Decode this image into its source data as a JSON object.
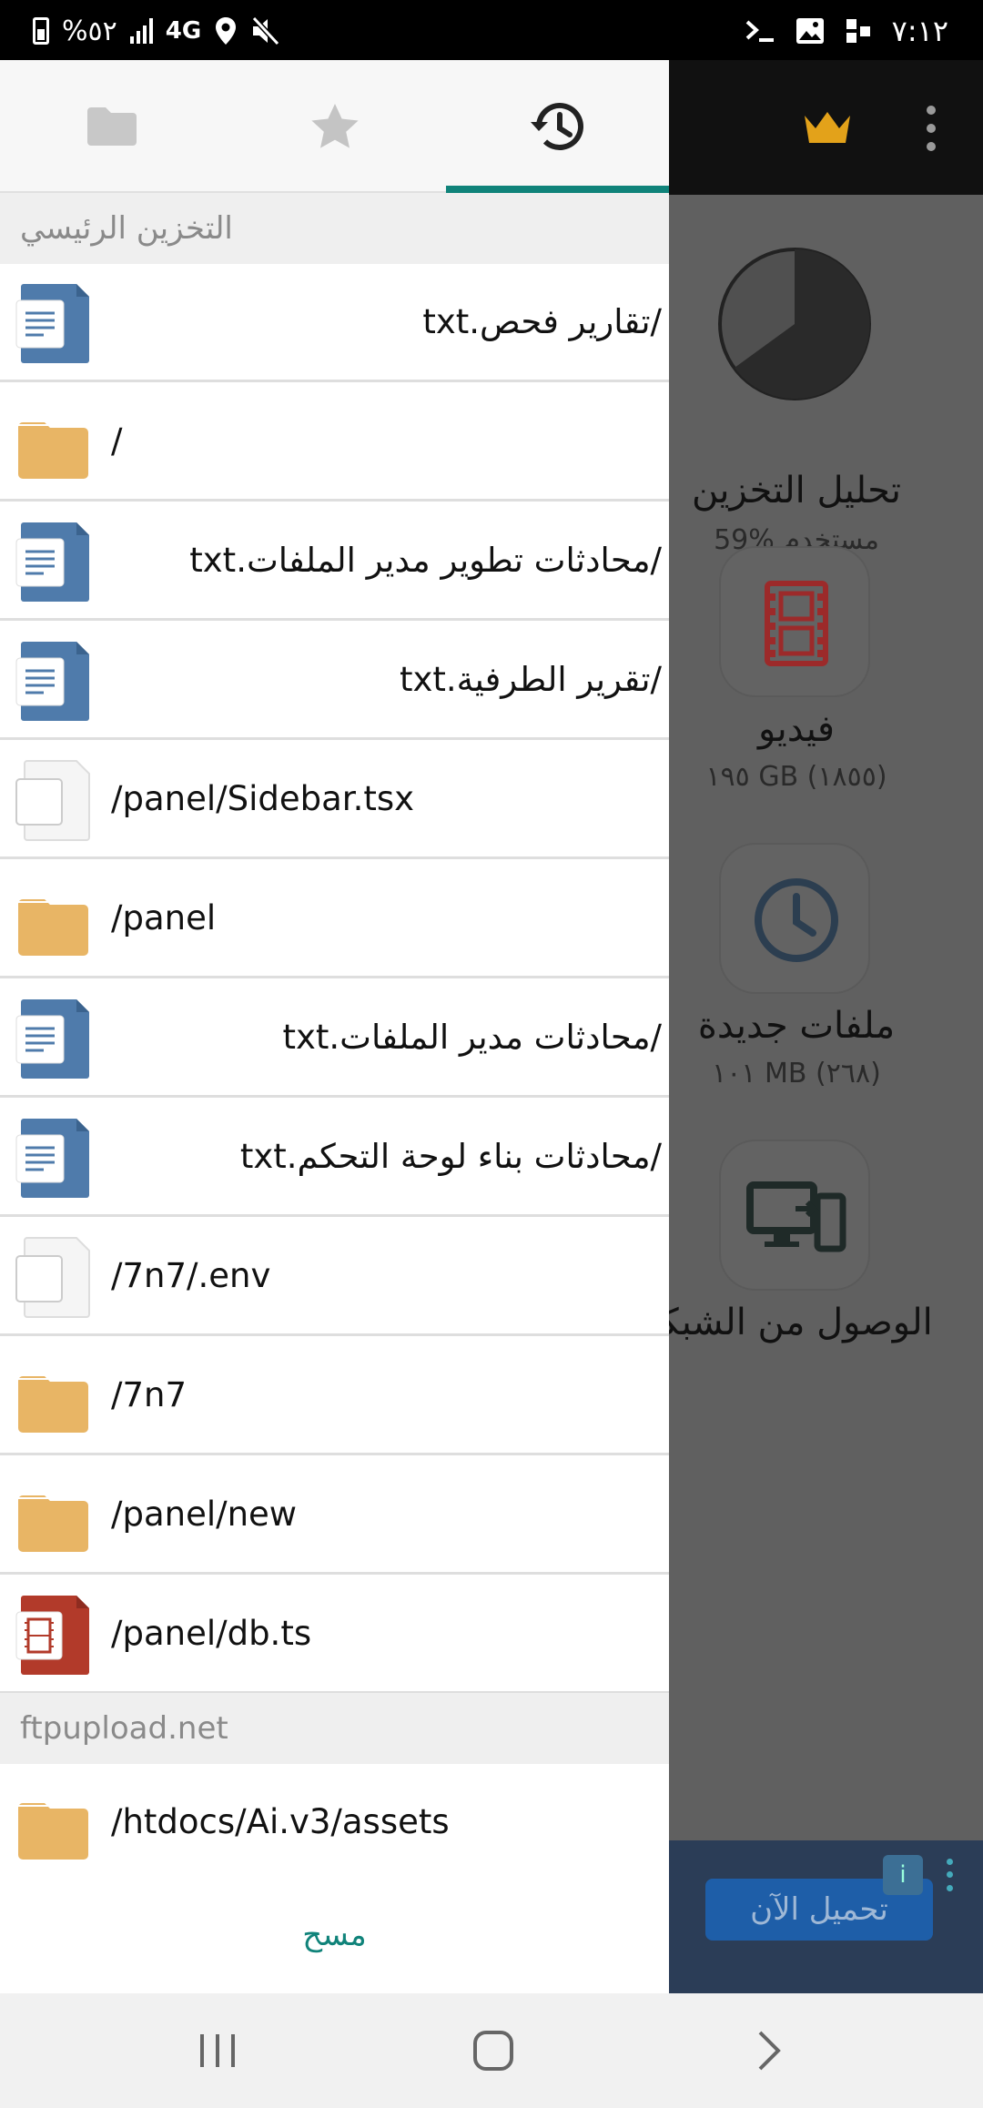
{
  "status_bar": {
    "battery_text": "%٥٢",
    "network": "4G",
    "time": "٧:١٢"
  },
  "drawer": {
    "tabs": [
      {
        "icon": "folder-icon",
        "active": false
      },
      {
        "icon": "star-icon",
        "active": false
      },
      {
        "icon": "history-icon",
        "active": true
      }
    ],
    "sections": [
      {
        "title": "التخزين الرئيسي",
        "items": [
          {
            "label": "/تقارير فحص.txt",
            "type": "text-file",
            "dir": "rtl"
          },
          {
            "label": "/",
            "type": "folder",
            "dir": "ltr"
          },
          {
            "label": "/محادثات تطوير مدير الملفات.txt",
            "type": "text-file",
            "dir": "rtl"
          },
          {
            "label": "/تقرير الطرفية.txt",
            "type": "text-file",
            "dir": "rtl"
          },
          {
            "label": "/panel/Sidebar.tsx",
            "type": "blank-file",
            "dir": "ltr"
          },
          {
            "label": "/panel",
            "type": "folder",
            "dir": "ltr"
          },
          {
            "label": "/محادثات مدير الملفات.txt",
            "type": "text-file",
            "dir": "rtl"
          },
          {
            "label": "/محادثات بناء لوحة التحكم.txt",
            "type": "text-file",
            "dir": "rtl"
          },
          {
            "label": "/7n7/.env",
            "type": "blank-file",
            "dir": "ltr"
          },
          {
            "label": "/7n7",
            "type": "folder",
            "dir": "ltr"
          },
          {
            "label": "/panel/new",
            "type": "folder",
            "dir": "ltr"
          },
          {
            "label": "/panel/db.ts",
            "type": "video-file",
            "dir": "ltr"
          }
        ]
      },
      {
        "title": "ftpupload.net",
        "items": [
          {
            "label": "/htdocs/Ai.v3/assets",
            "type": "folder",
            "dir": "ltr"
          }
        ]
      }
    ],
    "clear_label": "مسح"
  },
  "main": {
    "tiles": [
      {
        "title": "تحليل التخزين",
        "subtitle": "59% مستخدم",
        "icon": "pie-chart-icon",
        "used_fraction": 0.59
      },
      {
        "title": "فيديو",
        "subtitle": "١٩٥ GB (١٨٥٥)",
        "icon": "film-icon"
      },
      {
        "title": "ملفات جديدة",
        "subtitle": "١٠١ MB (٢٦٨)",
        "icon": "clock-icon"
      },
      {
        "title": "الوصول من الشبكة",
        "subtitle": "",
        "icon": "network-devices-icon"
      }
    ],
    "ad": {
      "button_label": "تحميل الآن"
    }
  },
  "colors": {
    "accent": "#10837a",
    "folder": "#e8b565",
    "doc_blue": "#4f7bab",
    "video_red": "#b23a2a"
  }
}
